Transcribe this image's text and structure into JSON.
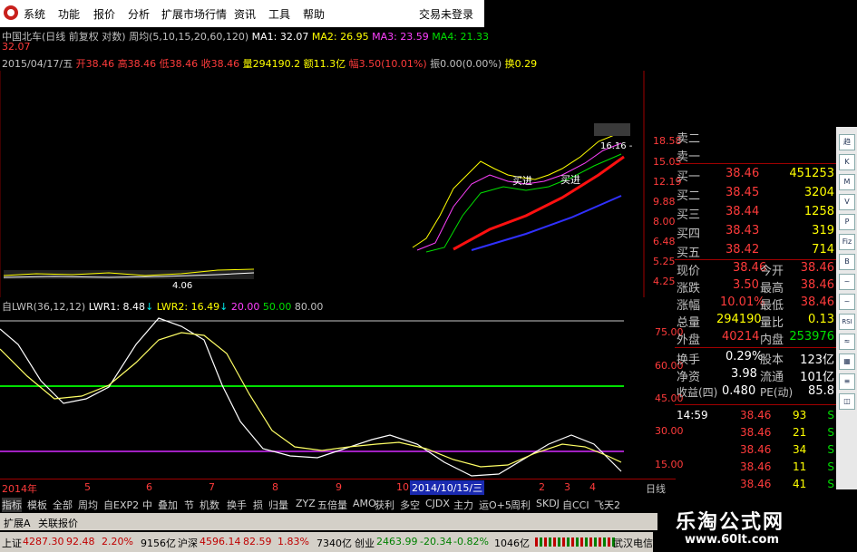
{
  "menu": {
    "items": [
      "系统",
      "功能",
      "报价",
      "分析",
      "扩展市场行情",
      "资讯",
      "工具",
      "帮助"
    ],
    "login": "交易未登录"
  },
  "header": {
    "title": "中国北车(日线 前复权 对数)",
    "ma_label": "周均(5,10,15,20,60,120)",
    "ma1": "MA1: 32.07",
    "ma2": "MA2: 26.95",
    "ma3": "MA3: 23.59",
    "ma4": "MA4: 21.33",
    "high_mark": "32.07"
  },
  "bar_info": {
    "date": "2015/04/17/五",
    "open": "开38.46",
    "high": "高38.46",
    "low": "低38.46",
    "close": "收38.46",
    "volume": "量294190.2",
    "amount": "额11.3亿",
    "change": "幅3.50(10.01%)",
    "amplitude": "振0.00(0.00%)",
    "turnover": "换0.29"
  },
  "price_axis": [
    "18.58",
    "15.05",
    "12.19",
    "9.88",
    "8.00",
    "6.48",
    "5.25",
    "4.25"
  ],
  "price_labels": {
    "buy1": "买进",
    "buy2": "买进",
    "peak": "16.16 -",
    "low": "4.06"
  },
  "indicator": {
    "name": "自LWR(36,12,12)",
    "lwr1": "LWR1: 8.48",
    "lwr1_arrow": "↓",
    "lwr2": "LWR2: 16.49",
    "lwr2_arrow": "↓",
    "l20": "20.00",
    "l50": "50.00",
    "l80": "80.00",
    "axis": [
      "75.00",
      "60.00",
      "45.00",
      "30.00",
      "15.00"
    ]
  },
  "time_axis": {
    "labels": [
      "2014年",
      "5",
      "6",
      "7",
      "8",
      "9",
      "10",
      "2",
      "3",
      "4"
    ],
    "highlight": "2014/10/15/三",
    "period": "日线"
  },
  "orderbook": {
    "sell": [
      {
        "label": "卖二"
      },
      {
        "label": "卖一"
      }
    ],
    "buy": [
      {
        "label": "买一",
        "price": "38.46",
        "vol": "451253"
      },
      {
        "label": "买二",
        "price": "38.45",
        "vol": "3204"
      },
      {
        "label": "买三",
        "price": "38.44",
        "vol": "1258"
      },
      {
        "label": "买四",
        "price": "38.43",
        "vol": "319"
      },
      {
        "label": "买五",
        "price": "38.42",
        "vol": "714"
      }
    ]
  },
  "quote": [
    {
      "l1": "现价",
      "v1": "38.46",
      "l2": "今开",
      "v2": "38.46"
    },
    {
      "l1": "涨跌",
      "v1": "3.50",
      "l2": "最高",
      "v2": "38.46"
    },
    {
      "l1": "涨幅",
      "v1": "10.01%",
      "l2": "最低",
      "v2": "38.46"
    },
    {
      "l1": "总量",
      "v1": "294190",
      "l2": "量比",
      "v2": "0.13"
    },
    {
      "l1": "外盘",
      "v1": "40214",
      "l2": "内盘",
      "v2": "253976"
    },
    {
      "l1": "换手",
      "v1": "0.29%",
      "l2": "股本",
      "v2": "123亿"
    },
    {
      "l1": "净资",
      "v1": "3.98",
      "l2": "流通",
      "v2": "101亿"
    },
    {
      "l1": "收益(四)",
      "v1": "0.480",
      "l2": "PE(动)",
      "v2": "85.8"
    }
  ],
  "ticks": [
    {
      "time": "14:59",
      "price": "38.46",
      "vol": "93",
      "side": "S"
    },
    {
      "time": "",
      "price": "38.46",
      "vol": "21",
      "side": "S"
    },
    {
      "time": "",
      "price": "38.46",
      "vol": "34",
      "side": "S"
    },
    {
      "time": "",
      "price": "38.46",
      "vol": "11",
      "side": "S"
    },
    {
      "time": "",
      "price": "38.46",
      "vol": "41",
      "side": "S"
    }
  ],
  "tools": [
    "趋",
    "K",
    "M",
    "V",
    "P",
    "Fiz",
    "B",
    "~",
    "~",
    "RSI",
    "≈",
    "▦",
    "≡",
    "◫"
  ],
  "tabs": [
    "指标",
    "模板",
    "全部",
    "周均",
    "自EXP2",
    "中",
    "叠加",
    "节",
    "机数",
    "换手",
    "损",
    "归量",
    "ZYZ",
    "五倍量",
    "AMO",
    "获利",
    "多空",
    "CJDX",
    "主力",
    "运O+5",
    "周利",
    "SKDJ",
    "自CCI",
    "飞天2"
  ],
  "ext_tabs": [
    "扩展A",
    "关联报价"
  ],
  "status": {
    "sh_label": "上证",
    "sh_val": "4287.30",
    "sh_chg": "92.48",
    "sh_pct": "2.20%",
    "sh_amt": "9156亿",
    "sz_label": "沪深",
    "sz_val": "4596.14",
    "sz_chg": "82.59",
    "sz_pct": "1.83%",
    "sz_amt": "7340亿",
    "cy_label": "创业",
    "cy_val": "2463.99",
    "cy_chg": "-20.34",
    "cy_pct": "-0.82%",
    "cy_amt": "1046亿",
    "server": "武汉电信主站"
  },
  "brand": {
    "name": "乐淘公式网",
    "url": "www.60lt.com"
  }
}
